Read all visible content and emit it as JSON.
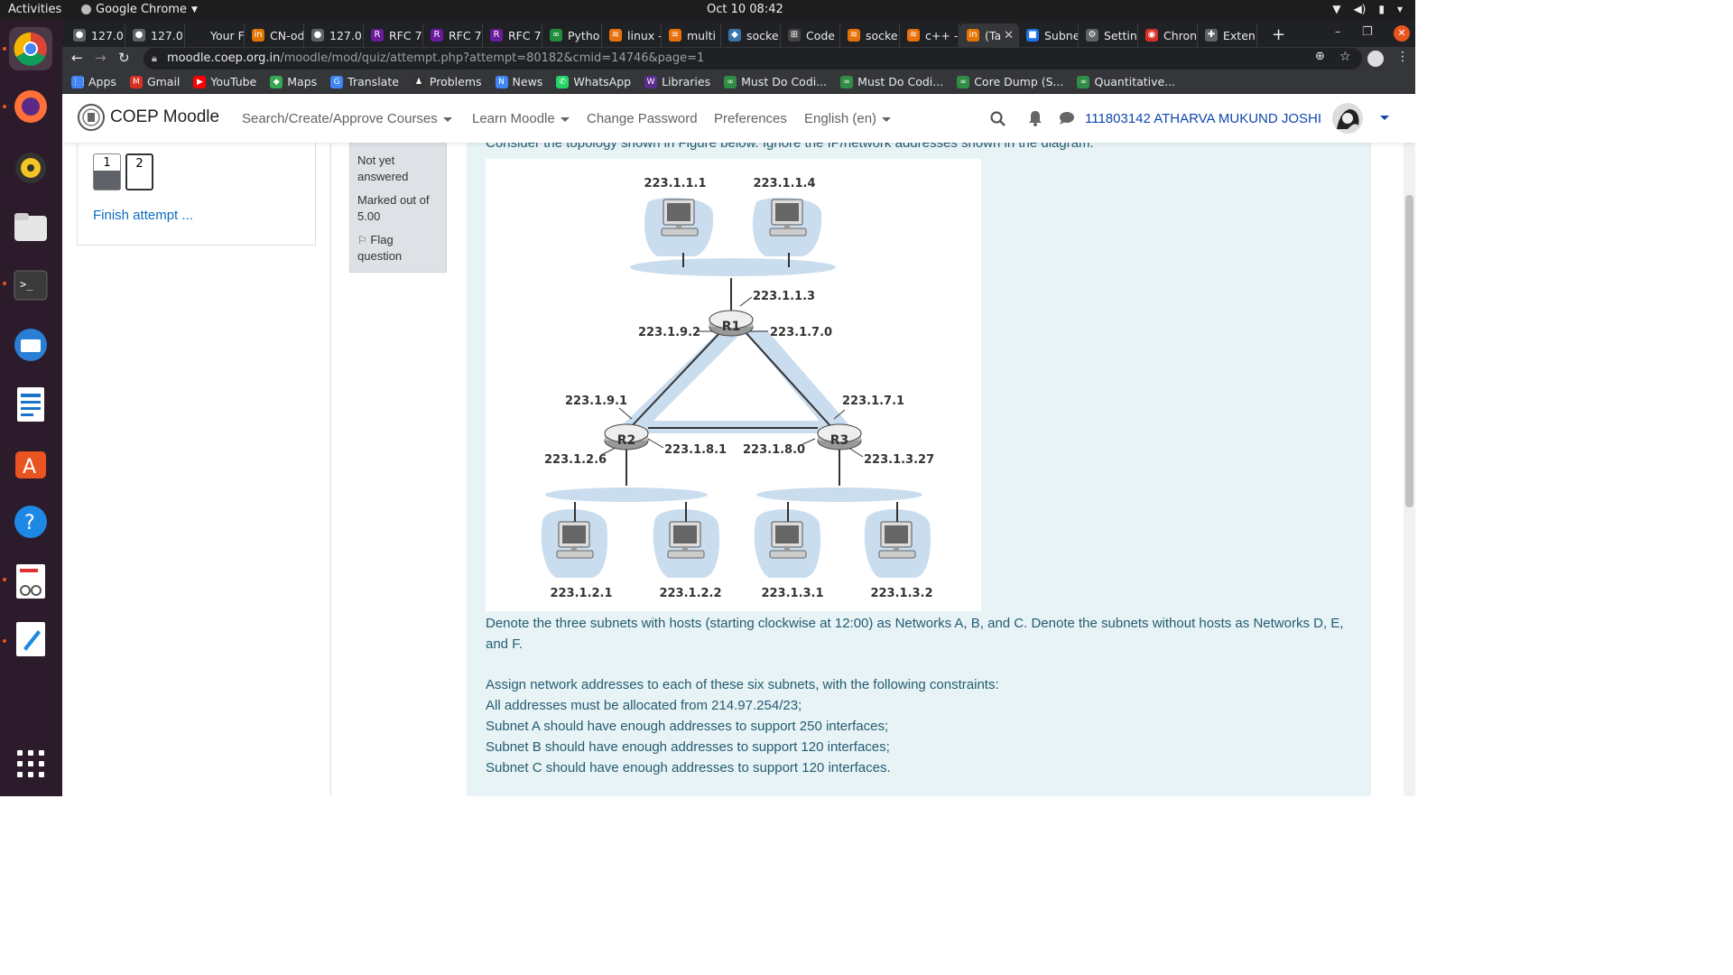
{
  "system": {
    "activities": "Activities",
    "app_name": "Google Chrome",
    "clock": "Oct 10  08:42"
  },
  "tabs": [
    {
      "label": "127.0.",
      "icon": "globe-icon",
      "color": "#5f6368"
    },
    {
      "label": "127.0.",
      "icon": "globe-icon",
      "color": "#5f6368"
    },
    {
      "label": "Your F",
      "icon": "blank-icon",
      "color": "#202124"
    },
    {
      "label": "CN-od",
      "icon": "in-icon",
      "color": "#e37400"
    },
    {
      "label": "127.0.",
      "icon": "globe-icon",
      "color": "#5f6368"
    },
    {
      "label": "RFC 7:",
      "icon": "rfc-icon",
      "color": "#6a1b9a"
    },
    {
      "label": "RFC 7:",
      "icon": "rfc-icon",
      "color": "#6a1b9a"
    },
    {
      "label": "RFC 7:",
      "icon": "rfc-icon",
      "color": "#6a1b9a"
    },
    {
      "label": "Pytho",
      "icon": "link-icon",
      "color": "#1e8e3e"
    },
    {
      "label": "linux -",
      "icon": "stack-icon",
      "color": "#e8710a"
    },
    {
      "label": "multi",
      "icon": "stack-icon",
      "color": "#e8710a"
    },
    {
      "label": "socke",
      "icon": "python-icon",
      "color": "#3776ab"
    },
    {
      "label": "Code",
      "icon": "code-icon",
      "color": "#444"
    },
    {
      "label": "socke",
      "icon": "stack-icon",
      "color": "#e8710a"
    },
    {
      "label": "c++ -",
      "icon": "stack-icon",
      "color": "#e8710a"
    },
    {
      "label": "(Ta",
      "icon": "in-icon",
      "color": "#e37400",
      "active": true
    },
    {
      "label": "Subne",
      "icon": "square-icon",
      "color": "#1a73e8"
    },
    {
      "label": "Settin",
      "icon": "gear-icon",
      "color": "#5f6368"
    },
    {
      "label": "Chron",
      "icon": "chrome-icon",
      "color": "#d93025"
    },
    {
      "label": "Exten",
      "icon": "puzzle-icon",
      "color": "#5f6368"
    }
  ],
  "url": {
    "host": "moodle.coep.org.in",
    "path": "/moodle/mod/quiz/attempt.php?attempt=80182&cmid=14746&page=1"
  },
  "bookmarks": [
    {
      "label": "Apps",
      "icon": "apps-grid-icon",
      "color": "#4285f4"
    },
    {
      "label": "Gmail",
      "icon": "gmail-icon",
      "color": "#d93025"
    },
    {
      "label": "YouTube",
      "icon": "youtube-icon",
      "color": "#ff0000"
    },
    {
      "label": "Maps",
      "icon": "maps-icon",
      "color": "#34a853"
    },
    {
      "label": "Translate",
      "icon": "translate-icon",
      "color": "#4285f4"
    },
    {
      "label": "Problems",
      "icon": "problems-icon",
      "color": "#333"
    },
    {
      "label": "News",
      "icon": "news-icon",
      "color": "#4285f4"
    },
    {
      "label": "WhatsApp",
      "icon": "whatsapp-icon",
      "color": "#25d366"
    },
    {
      "label": "Libraries",
      "icon": "w-icon",
      "color": "#5c2d91"
    },
    {
      "label": "Must Do Codi...",
      "icon": "gfg-icon",
      "color": "#2f8d46"
    },
    {
      "label": "Must Do Codi...",
      "icon": "gfg-icon",
      "color": "#2f8d46"
    },
    {
      "label": "Core Dump (S...",
      "icon": "gfg-icon",
      "color": "#2f8d46"
    },
    {
      "label": "Quantitative...",
      "icon": "gfg-icon",
      "color": "#2f8d46"
    }
  ],
  "moodle": {
    "brand": "COEP Moodle",
    "menu": {
      "courses": "Search/Create/Approve Courses",
      "learn": "Learn Moodle",
      "password": "Change Password",
      "prefs": "Preferences",
      "lang": "English (en)"
    },
    "user": "111803142 ATHARVA MUKUND JOSHI"
  },
  "quiz_nav": {
    "buttons": [
      "1",
      "2"
    ],
    "finish": "Finish attempt ..."
  },
  "question_info": {
    "status": "Not yet answered",
    "marked": "Marked out of 5.00",
    "flag": "Flag question"
  },
  "question": {
    "top_line": "Consider the topology shown in Figure below. Ignore the IP/network addresses shown in the diagram.",
    "p1": "Denote the three subnets with hosts (starting clockwise at 12:00) as Networks A, B, and C. Denote the subnets without hosts as Networks D, E, and F.",
    "p2": "Assign network addresses to each of these six subnets, with the following constraints:",
    "c1": "All addresses must be allocated from 214.97.254/23;",
    "c2": "Subnet A should have enough addresses to support 250 interfaces;",
    "c3": "Subnet B should have enough addresses to support 120 interfaces;",
    "c4": "Subnet C should have enough addresses to support 120 interfaces."
  },
  "diagram": {
    "routers": {
      "r1": "R1",
      "r2": "R2",
      "r3": "R3"
    },
    "hosts": {
      "h1": "223.1.1.1",
      "h4": "223.1.1.4",
      "h21": "223.1.2.1",
      "h22": "223.1.2.2",
      "h31": "223.1.3.1",
      "h32": "223.1.3.2"
    },
    "ifaces": {
      "r1_top": "223.1.1.3",
      "r1_left": "223.1.9.2",
      "r1_right": "223.1.7.0",
      "r2_top": "223.1.9.1",
      "r2_left": "223.1.2.6",
      "r2_right": "223.1.8.1",
      "r3_left": "223.1.8.0",
      "r3_top": "223.1.7.1",
      "r3_right": "223.1.3.27"
    }
  }
}
